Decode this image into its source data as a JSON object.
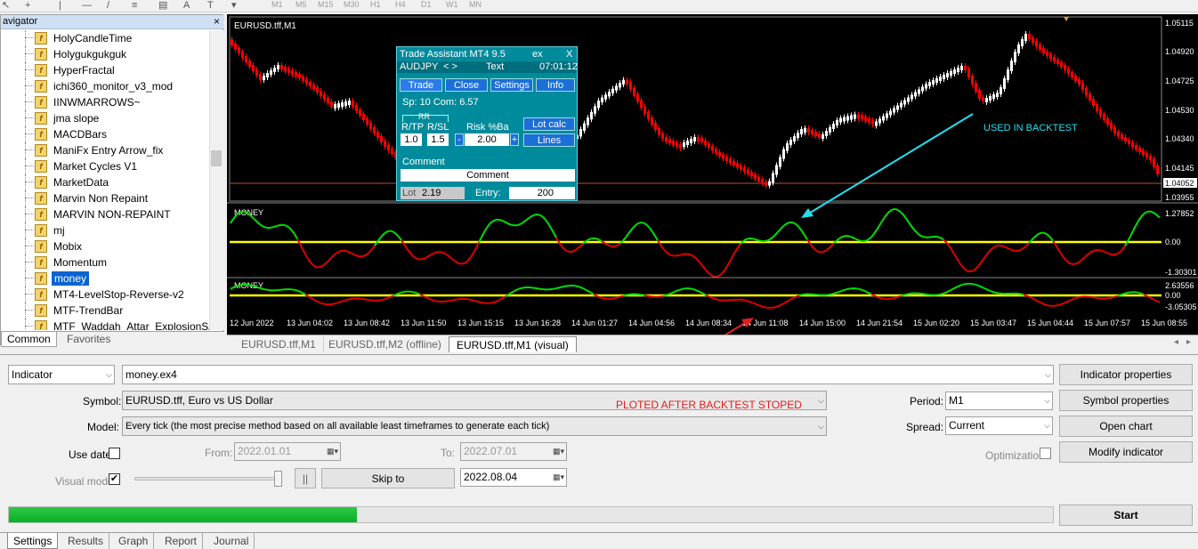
{
  "toolbar": {
    "timeframes": [
      "M1",
      "M5",
      "M15",
      "M30",
      "H1",
      "H4",
      "D1",
      "W1",
      "MN"
    ],
    "text_tool": "A"
  },
  "navigator": {
    "title": "avigator",
    "close": "×",
    "items": [
      "HolyCandleTime",
      "Holygukgukguk",
      "HyperFractal",
      "ichi360_monitor_v3_mod",
      "IINWMARROWS~",
      "jma slope",
      "MACDBars",
      "ManiFx Entry Arrow_fix",
      "Market Cycles V1",
      "MarketData",
      "Marvin Non Repaint",
      "MARVIN NON-REPAINT",
      "mj",
      "Mobix",
      "Momentum",
      "money",
      "MT4-LevelStop-Reverse-v2",
      "MTF-TrendBar",
      "MTF_Waddah_Attar_ExplosionSA"
    ],
    "selected_index": 15,
    "tabs": [
      "Common",
      "Favorites"
    ]
  },
  "chart": {
    "title": "EURUSD.tff,M1",
    "price_axis": [
      "1.05115",
      "1.04920",
      "1.04725",
      "1.04530",
      "1.04340",
      "1.04145",
      "1.04052",
      "1.03955"
    ],
    "current_price": "1.04052",
    "indicator1": {
      "name": "MONEY",
      "levels": [
        "1.27852",
        "0.00",
        "-1.30301"
      ]
    },
    "indicator2": {
      "name": "MONEY",
      "levels": [
        "2.63556",
        "0.00",
        "-3.05305"
      ]
    },
    "time_axis": [
      "12 Jun 2022",
      "13 Jun 04:02",
      "13 Jun 08:42",
      "13 Jun 11:50",
      "13 Jun 15:15",
      "13 Jun 16:28",
      "14 Jun 01:27",
      "14 Jun 04:56",
      "14 Jun 08:34",
      "14 Jun 11:08",
      "14 Jun 15:00",
      "14 Jun 21:54",
      "15 Jun 02:20",
      "15 Jun 03:47",
      "15 Jun 04:44",
      "15 Jun 07:57",
      "15 Jun 08:55"
    ],
    "annotations": {
      "used": "USED IN BACKTEST",
      "ploted": "PLOTED AFTER BACKTEST STOPED"
    },
    "colors": {
      "bull": "#ffffff",
      "bear": "#ff0000",
      "indicator_up": "#00e000",
      "indicator_down": "#e00000",
      "zero_line": "#ffff00",
      "annotation_cyan": "#22e0f0",
      "annotation_red": "#e02020"
    }
  },
  "trade_assistant": {
    "title": "Trade Assistant MT4 9.5",
    "title_suffix": "ex",
    "close": "X",
    "symbol": "AUDJPY",
    "nav_buttons": "< > ",
    "text_label": "Text",
    "time": "07:01:12",
    "tabs": [
      "Trade",
      "Close",
      "Settings",
      "Info"
    ],
    "spread_info": "Sp: 10  Com: 6.57",
    "rr_label": "RR",
    "rtp_label": "R/TP",
    "rsl_label": "R/SL",
    "risk_label": "Risk %Ba",
    "lot_calc": "Lot calc",
    "lines": "Lines",
    "rtp_value": "1.0",
    "rsl_value": "1.5",
    "minus": "-",
    "plus": "+",
    "risk_value": "2.00",
    "comment_label": "Comment",
    "comment_value": "Comment",
    "lot_label": "Lot",
    "lot_value": "2.19",
    "entry_label": "Entry:",
    "entry_value": "200"
  },
  "chart_tabs": [
    "EURUSD.tff,M1",
    "EURUSD.tff,M2 (offline)",
    "EURUSD.tff,M1 (visual)"
  ],
  "tester": {
    "type": "Indicator",
    "program": "money.ex4",
    "symbol_label": "Symbol:",
    "symbol_value": "EURUSD.tff, Euro vs US Dollar",
    "model_label": "Model:",
    "model_value": "Every tick (the most precise method based on all available least timeframes to generate each tick)",
    "use_date_label": "Use date",
    "from_label": "From:",
    "from_value": "2022.01.01",
    "to_label": "To:",
    "to_value": "2022.07.01",
    "visual_mode_label": "Visual mode",
    "visual_check": "✔",
    "pause": "||",
    "skip_to": "Skip to",
    "skip_date": "2022.08.04",
    "period_label": "Period:",
    "period_value": "M1",
    "spread_label": "Spread:",
    "spread_value": "Current",
    "optimization_label": "Optimization",
    "buttons": [
      "Indicator properties",
      "Symbol properties",
      "Open chart",
      "Modify indicator"
    ],
    "start": "Start",
    "progress": 0.333,
    "tabs": [
      "Settings",
      "Results",
      "Graph",
      "Report",
      "Journal"
    ]
  }
}
